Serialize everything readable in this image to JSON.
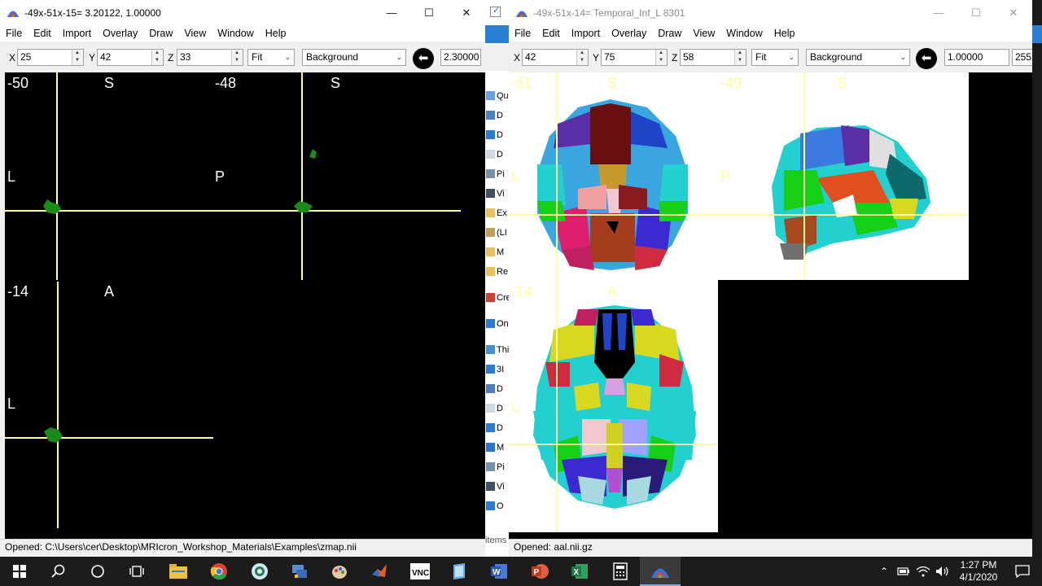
{
  "left_window": {
    "title": "-49x-51x-15= 3.20122, 1.00000",
    "menu": [
      "File",
      "Edit",
      "Import",
      "Overlay",
      "Draw",
      "View",
      "Window",
      "Help"
    ],
    "x_label": "X",
    "x_value": "25",
    "y_label": "Y",
    "y_value": "42",
    "z_label": "Z",
    "z_value": "33",
    "zoom": "Fit",
    "layer": "Background",
    "contrast_value": "2.30000",
    "views": {
      "sagittal_slice": "-50",
      "sagittal_orient_top": "S",
      "sagittal_orient_left": "L",
      "coronal_slice": "-48",
      "coronal_orient_top": "S",
      "coronal_orient_left": "P",
      "axial_slice": "-14",
      "axial_orient_top": "A",
      "axial_orient_left": "L"
    },
    "status": "Opened: C:\\Users\\cer\\Desktop\\MRIcron_Workshop_Materials\\Examples\\zmap.nii"
  },
  "right_window": {
    "title": "-49x-51x-14= Temporal_Inf_L 8301",
    "menu": [
      "File",
      "Edit",
      "Import",
      "Overlay",
      "Draw",
      "View",
      "Window",
      "Help"
    ],
    "x_label": "X",
    "x_value": "42",
    "y_label": "Y",
    "y_value": "75",
    "z_label": "Z",
    "z_value": "58",
    "zoom": "Fit",
    "layer": "Background",
    "contrast_value": "1.00000",
    "max_value": "255",
    "views": {
      "view1_slice": "-51",
      "view1_orient_top": "S",
      "view1_orient_left": "L",
      "view2_slice": "-49",
      "view2_orient_top": "S",
      "view2_orient_left": "P",
      "view3_slice": "-14",
      "view3_orient_top": "A",
      "view3_orient_left": "L"
    },
    "status": "Opened: aal.nii.gz"
  },
  "explorer_items": [
    "Qu",
    "D",
    "D",
    "D",
    "Pi",
    "Vi",
    "Ex",
    "(LI",
    "M",
    "Re",
    "Cre",
    "On",
    "Thi",
    "3I",
    "D",
    "D",
    "D",
    "M",
    "Pi",
    "Vi",
    "O",
    "items"
  ],
  "taskbar": {
    "time": "1:27 PM",
    "date": "4/1/2020",
    "apps": [
      "windows-start",
      "search",
      "cortana",
      "task-view",
      "file-explorer",
      "chrome",
      "network-app",
      "remote-app",
      "paint-app",
      "matlab",
      "vnc",
      "notepad-app",
      "word",
      "powerpoint",
      "excel",
      "calculator",
      "mricron"
    ]
  },
  "colors": {
    "crosshair": "#ffff99",
    "activation": "#1a8a1a",
    "viewer_bg": "#000000",
    "atlas_bg": "#ffffff"
  }
}
